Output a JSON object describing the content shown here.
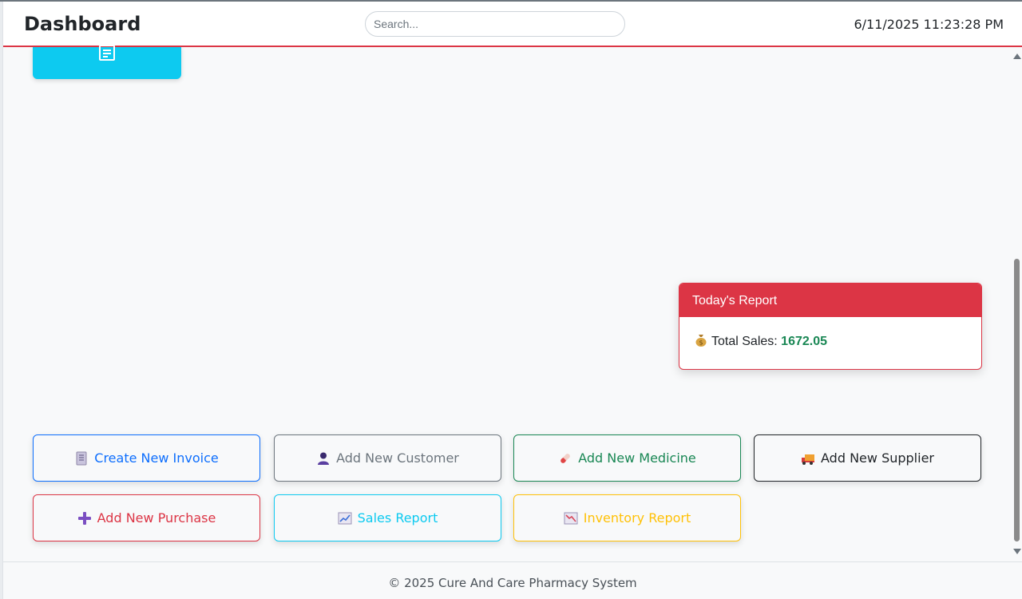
{
  "header": {
    "title": "Dashboard",
    "search_placeholder": "Search...",
    "datetime": "6/11/2025 11:23:28 PM"
  },
  "report": {
    "title": "Today's Report",
    "total_sales_label": "Total Sales:",
    "total_sales_value": "1672.05"
  },
  "actions": {
    "create_invoice": "Create New Invoice",
    "add_customer": "Add New Customer",
    "add_medicine": "Add New Medicine",
    "add_supplier": "Add New Supplier",
    "add_purchase": "Add New Purchase",
    "sales_report": "Sales Report",
    "inventory_report": "Inventory Report"
  },
  "icons": {
    "top_card": "invoice-icon",
    "money": "money-bag-icon",
    "invoice": "receipt-icon",
    "customer": "user-icon",
    "medicine": "pill-icon",
    "supplier": "truck-icon",
    "purchase": "plus-icon",
    "sales": "chart-up-icon",
    "inventory": "chart-down-icon"
  },
  "colors": {
    "primary": "#0d6efd",
    "secondary": "#6c757d",
    "success": "#198754",
    "dark": "#212529",
    "danger": "#dc3545",
    "info": "#0dcaf0",
    "warning": "#ffc107"
  },
  "footer": {
    "text": "© 2025 Cure And Care Pharmacy System"
  }
}
